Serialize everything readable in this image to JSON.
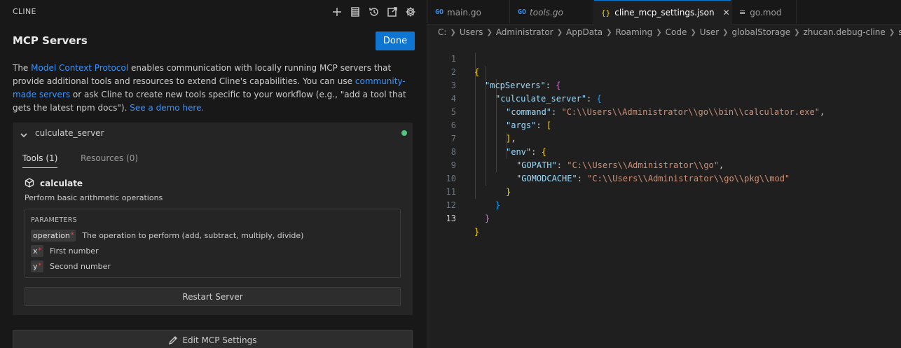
{
  "panel": {
    "title": "CLINE",
    "heading": "MCP Servers",
    "done_label": "Done",
    "toolbar_icons": [
      "plus-icon",
      "list-icon",
      "history-icon",
      "popout-icon",
      "gear-icon"
    ],
    "desc": {
      "t1": "The ",
      "link1": "Model Context Protocol",
      "t2": " enables communication with locally running MCP servers that provide additional tools and resources to extend Cline's capabilities. You can use ",
      "link2": "community-made servers",
      "t3": " or ask Cline to create new tools specific to your workflow (e.g., \"add a tool that gets the latest npm docs\"). ",
      "link3": "See a demo here."
    },
    "server": {
      "name": "culculate_server",
      "status_color": "#4ec97a",
      "tabs": [
        "Tools (1)",
        "Resources (0)"
      ],
      "tool": {
        "name": "calculate",
        "description": "Perform basic arithmetic operations",
        "params_title": "PARAMETERS",
        "params": [
          {
            "name": "operation",
            "required": "*",
            "desc": "The operation to perform (add, subtract, multiply, divide)"
          },
          {
            "name": "x",
            "required": "*",
            "desc": "First number"
          },
          {
            "name": "y",
            "required": "*",
            "desc": "Second number"
          }
        ]
      },
      "restart_label": "Restart Server"
    },
    "edit_label": "Edit MCP Settings"
  },
  "editor": {
    "tabs": [
      {
        "icon": "go-icon",
        "label": "main.go"
      },
      {
        "icon": "go-icon",
        "label": "tools.go"
      },
      {
        "icon": "json-icon",
        "label": "cline_mcp_settings.json"
      },
      {
        "icon": "mod-icon",
        "label": "go.mod"
      }
    ],
    "active_tab": 2,
    "breadcrumb": [
      "C:",
      "Users",
      "Administrator",
      "AppData",
      "Roaming",
      "Code",
      "User",
      "globalStorage",
      "zhucan.debug-cline",
      "settings"
    ],
    "line_numbers": [
      "1",
      "2",
      "3",
      "4",
      "5",
      "6",
      "7",
      "8",
      "9",
      "10",
      "11",
      "12",
      "13"
    ],
    "code": {
      "l1_open": "{",
      "l2_key": "\"mcpServers\"",
      "l2_rest": ": ",
      "l2_open": "{",
      "l3_key": "\"culculate_server\"",
      "l3_rest": ": ",
      "l3_open": "{",
      "l4_key": "\"command\"",
      "l4_colon": ": ",
      "l4_val": "\"C:\\\\Users\\\\Administrator\\\\go\\\\bin\\\\calculator.exe\"",
      "l4_comma": ",",
      "l5_key": "\"args\"",
      "l5_colon": ": ",
      "l5_open": "[",
      "l6_close": "]",
      "l6_comma": ",",
      "l7_key": "\"env\"",
      "l7_colon": ": ",
      "l7_open": "{",
      "l8_key": "\"GOPATH\"",
      "l8_colon": ": ",
      "l8_val": "\"C:\\\\Users\\\\Administrator\\\\go\"",
      "l8_comma": ",",
      "l9_key": "\"GOMODCACHE\"",
      "l9_colon": ": ",
      "l9_val": "\"C:\\\\Users\\\\Administrator\\\\go\\\\pkg\\\\mod\"",
      "l10_close": "}",
      "l11_close": "}",
      "l12_close": "}",
      "l13_close": "}"
    }
  }
}
